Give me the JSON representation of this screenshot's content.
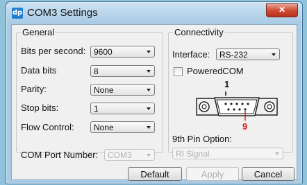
{
  "window": {
    "title": "COM3 Settings",
    "icon_text": "dp",
    "close_glyph": "✕"
  },
  "general": {
    "legend": "General",
    "bits_label": "Bits per second:",
    "bits_value": "9600",
    "databits_label": "Data bits",
    "databits_value": "8",
    "parity_label": "Parity:",
    "parity_value": "None",
    "stopbits_label": "Stop bits:",
    "stopbits_value": "1",
    "flow_label": "Flow Control:",
    "flow_value": "None",
    "port_label": "COM Port Number:",
    "port_value": "COM3"
  },
  "connectivity": {
    "legend": "Connectivity",
    "interface_label": "Interface:",
    "interface_value": "RS-232",
    "powered_label": "PoweredCOM",
    "pin1_label": "1",
    "pin9_label": "9",
    "pin9_option_label": "9th Pin Option:",
    "pin9_option_value": "RI Signal"
  },
  "buttons": {
    "default": "Default",
    "apply": "Apply",
    "cancel": "Cancel"
  },
  "colors": {
    "pin9_highlight": "#d42020",
    "title_bar": "#a9cbe5"
  }
}
